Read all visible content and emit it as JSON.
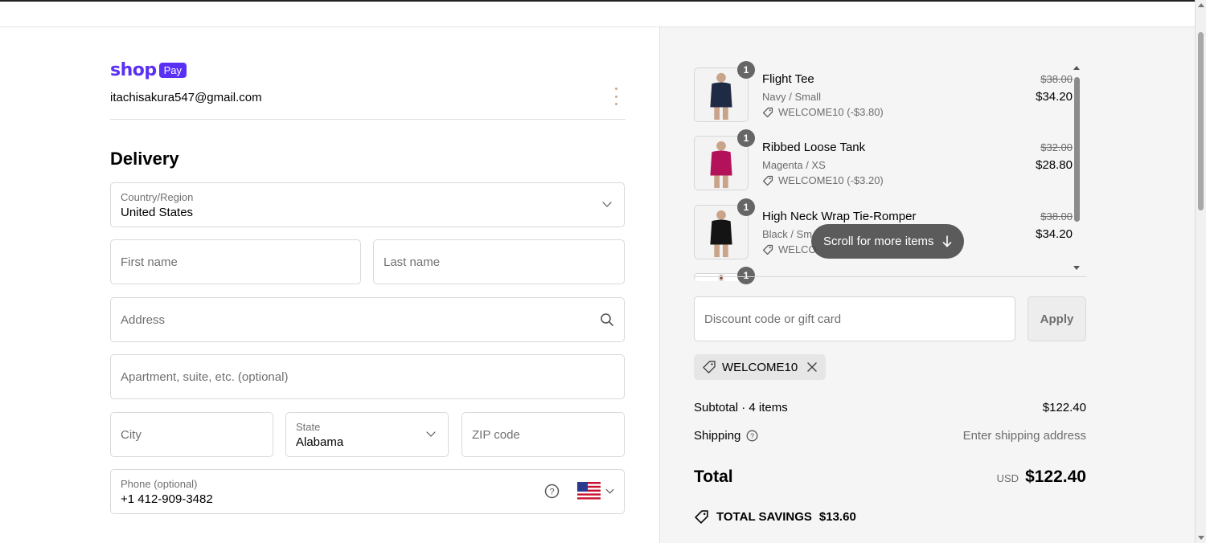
{
  "brand": {
    "logo_text": "shop",
    "logo_badge": "Pay"
  },
  "account": {
    "email": "itachisakura547@gmail.com"
  },
  "delivery": {
    "heading": "Delivery",
    "country": {
      "label": "Country/Region",
      "value": "United States"
    },
    "first_name": {
      "placeholder": "First name"
    },
    "last_name": {
      "placeholder": "Last name"
    },
    "address": {
      "placeholder": "Address"
    },
    "apartment": {
      "placeholder": "Apartment, suite, etc. (optional)"
    },
    "city": {
      "placeholder": "City"
    },
    "state": {
      "label": "State",
      "value": "Alabama"
    },
    "zip": {
      "placeholder": "ZIP code"
    },
    "phone": {
      "label": "Phone (optional)",
      "value": "+1 412-909-3482",
      "country_flag": "us-flag-icon"
    }
  },
  "cart": {
    "items": [
      {
        "name": "Flight Tee",
        "variant": "Navy / Small",
        "discount": "WELCOME10 (-$3.80)",
        "old_price": "$38.00",
        "price": "$34.20",
        "qty": "1",
        "color": "#1f2a44"
      },
      {
        "name": "Ribbed Loose Tank",
        "variant": "Magenta / XS",
        "discount": "WELCOME10 (-$3.20)",
        "old_price": "$32.00",
        "price": "$28.80",
        "qty": "1",
        "color": "#b3125a"
      },
      {
        "name": "High Neck Wrap Tie-Romper",
        "variant": "Black / Sm",
        "discount": "WELCO",
        "old_price": "$38.00",
        "price": "$34.20",
        "qty": "1",
        "color": "#141414"
      },
      {
        "qty": "1"
      }
    ],
    "scroll_hint": "Scroll for more items"
  },
  "discount": {
    "placeholder": "Discount code or gift card",
    "apply_label": "Apply",
    "applied_code": "WELCOME10"
  },
  "summary": {
    "subtotal_label": "Subtotal · 4 items",
    "subtotal_value": "$122.40",
    "shipping_label": "Shipping",
    "shipping_value": "Enter shipping address",
    "total_label": "Total",
    "total_currency": "USD",
    "total_value": "$122.40",
    "savings_label": "TOTAL SAVINGS",
    "savings_value": "$13.60"
  },
  "colors": {
    "shop_purple": "#5a31f4",
    "panel_bg": "#f5f5f5"
  }
}
